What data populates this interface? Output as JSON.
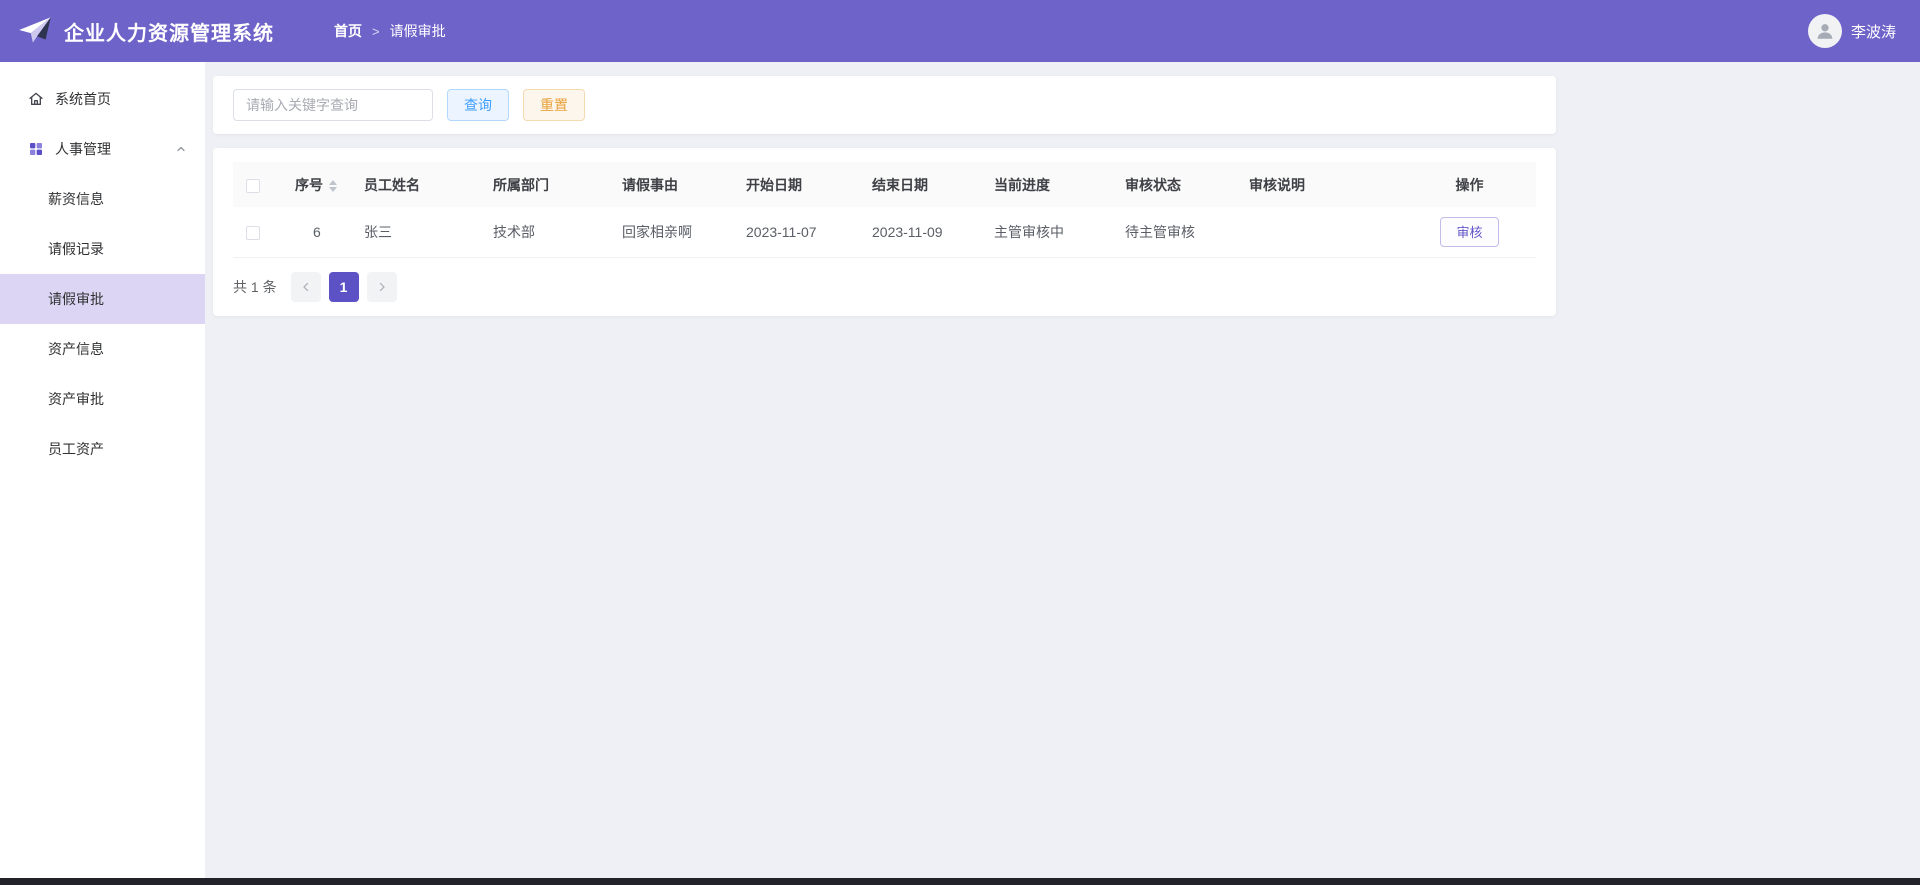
{
  "header": {
    "title": "企业人力资源管理系统",
    "breadcrumb": {
      "home": "首页",
      "separator": ">",
      "current": "请假审批"
    },
    "user": {
      "name": "李波涛"
    }
  },
  "sidebar": {
    "home": "系统首页",
    "hr": "人事管理",
    "sub": [
      "薪资信息",
      "请假记录",
      "请假审批",
      "资产信息",
      "资产审批",
      "员工资产"
    ],
    "active_item": "请假审批"
  },
  "search": {
    "placeholder": "请输入关键字查询",
    "query_label": "查询",
    "reset_label": "重置"
  },
  "table": {
    "columns": [
      "序号",
      "员工姓名",
      "所属部门",
      "请假事由",
      "开始日期",
      "结束日期",
      "当前进度",
      "审核状态",
      "审核说明",
      "操作"
    ],
    "rows": [
      {
        "index": "6",
        "name": "张三",
        "dept": "技术部",
        "reason": "回家相亲啊",
        "start": "2023-11-07",
        "end": "2023-11-09",
        "progress": "主管审核中",
        "status": "待主管审核",
        "note": "",
        "action": "审核"
      }
    ]
  },
  "pagination": {
    "total": "共 1 条",
    "current": "1"
  },
  "colors": {
    "header_bg": "#6e63c9",
    "primary": "#5d51c6",
    "sidebar_active_bg": "#dcd6f4",
    "query_btn": "#409eff",
    "reset_btn": "#e6a23c",
    "main_bg": "#eef0f5"
  }
}
